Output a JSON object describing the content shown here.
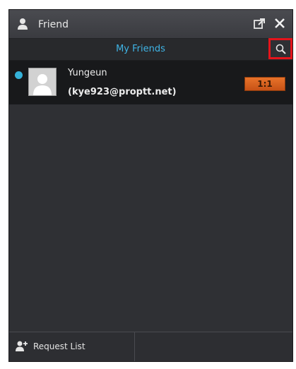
{
  "window": {
    "title": "Friend",
    "title_icon": "person-icon",
    "popout_icon": "popout-icon",
    "close_icon": "close-icon"
  },
  "tabs": {
    "active_label": "My Friends",
    "search_icon": "search-icon"
  },
  "friends": [
    {
      "name": "Yungeun",
      "email": "(kye923@proptt.net)",
      "status": "online",
      "chat_label": "1:1"
    }
  ],
  "footer": {
    "request_label": "Request List",
    "request_icon": "add-person-icon"
  },
  "colors": {
    "accent": "#3fb4e6",
    "status_online": "#35b2d9",
    "chat_button": "#d9611f",
    "highlight": "#e5141b"
  }
}
